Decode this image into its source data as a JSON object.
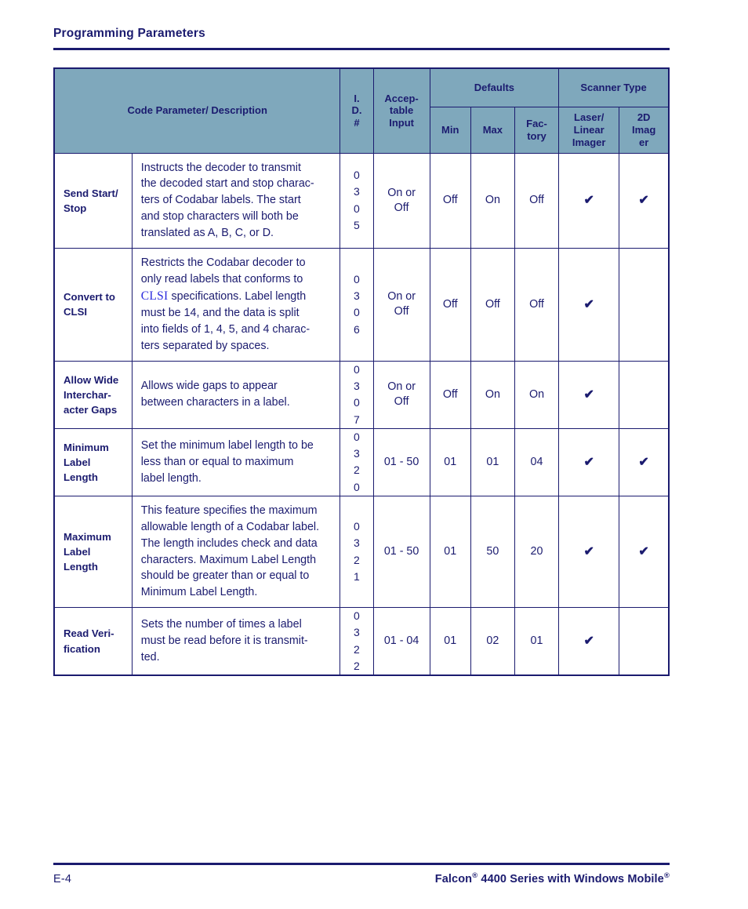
{
  "header": {
    "title": "Programming Parameters"
  },
  "table": {
    "headers": {
      "description": "Code Parameter/ Description",
      "id": "I. D. #",
      "id_lines": [
        "I.",
        "D.",
        "#"
      ],
      "acceptable_input": "Acceptable Input",
      "acceptable_input_lines": [
        "Accep-",
        "table",
        "Input"
      ],
      "defaults_group": "Defaults",
      "scanner_type_group": "Scanner Type",
      "min": "Min",
      "max": "Max",
      "factory": "Factory",
      "factory_lines": [
        "Fac-",
        "tory"
      ],
      "laser_linear_imager": "Laser/ Linear Imager",
      "laser_linear_imager_lines": [
        "Laser/",
        "Linear",
        "Imager"
      ],
      "imager_2d": "2D Imager",
      "imager_2d_lines": [
        "2D",
        "Imag",
        "er"
      ]
    },
    "rows": [
      {
        "name": "Send Start/ Stop",
        "name_lines": [
          "Send Start/",
          "Stop"
        ],
        "description": "Instructs the decoder to transmit the decoded start and stop charac-ters of Codabar labels. The start and stop characters will both be translated as A, B, C, or D.",
        "description_lines": [
          "Instructs the decoder to transmit",
          "the decoded start and stop charac-",
          "ters of Codabar labels. The start",
          "and stop characters will both be",
          "translated as A, B, C, or D."
        ],
        "id": "0305",
        "id_digits": [
          "0",
          "3",
          "0",
          "5"
        ],
        "acceptable_input": "On or Off",
        "acceptable_input_lines": [
          "On or",
          "Off"
        ],
        "min": "Off",
        "max": "On",
        "factory": "Off",
        "laser_linear_imager": "✔",
        "imager_2d": "✔"
      },
      {
        "name": "Convert to CLSI",
        "name_lines": [
          "Convert to",
          "CLSI"
        ],
        "description": "Restricts the Codabar decoder to only read labels that conforms to CLSI specifications. Label length must be 14, and the data is split into fields of 1, 4, 5, and 4 charac-ters separated by spaces.",
        "description_lines": [
          "Restricts the Codabar decoder to",
          "only read labels that conforms to",
          "CLSI specifications. Label length",
          "must be 14, and the data is split",
          "into fields of 1, 4, 5, and 4 charac-",
          "ters separated by spaces."
        ],
        "xref_term": "CLSI",
        "id": "0306",
        "id_digits": [
          "0",
          "3",
          "0",
          "6"
        ],
        "acceptable_input": "On or Off",
        "acceptable_input_lines": [
          "On or",
          "Off"
        ],
        "min": "Off",
        "max": "Off",
        "factory": "Off",
        "laser_linear_imager": "✔",
        "imager_2d": ""
      },
      {
        "name": "Allow Wide Interchar-acter Gaps",
        "name_lines": [
          "Allow Wide",
          "Interchar-",
          "acter Gaps"
        ],
        "description": "Allows wide gaps to appear between characters in a label.",
        "description_lines": [
          "Allows wide gaps to appear",
          "between characters in a label."
        ],
        "id": "0307",
        "id_digits": [
          "0",
          "3",
          "0",
          "7"
        ],
        "acceptable_input": "On or Off",
        "acceptable_input_lines": [
          "On or",
          "Off"
        ],
        "min": "Off",
        "max": "On",
        "factory": "On",
        "laser_linear_imager": "✔",
        "imager_2d": ""
      },
      {
        "name": "Minimum Label Length",
        "name_lines": [
          "Minimum",
          "Label",
          "Length"
        ],
        "description": "Set the minimum label length to be less than or equal to maximum label length.",
        "description_lines": [
          "Set the minimum label length to be",
          "less than or equal to maximum",
          "label length."
        ],
        "id": "0320",
        "id_digits": [
          "0",
          "3",
          "2",
          "0"
        ],
        "acceptable_input": "01 - 50",
        "acceptable_input_lines": [
          "01 - 50"
        ],
        "min": "01",
        "max": "01",
        "factory": "04",
        "laser_linear_imager": "✔",
        "imager_2d": "✔"
      },
      {
        "name": "Maximum Label Length",
        "name_lines": [
          "Maximum",
          "Label",
          "Length"
        ],
        "description": "This feature specifies the maximum allowable length of a Codabar label. The length includes check and data characters. Maximum Label Length should be greater than or equal to Minimum Label Length.",
        "description_lines": [
          "This feature specifies the maximum",
          "allowable length of a Codabar label.",
          "The length includes check and data",
          "characters. Maximum Label Length",
          "should be greater than or equal to",
          "Minimum Label Length."
        ],
        "id": "0321",
        "id_digits": [
          "0",
          "3",
          "2",
          "1"
        ],
        "acceptable_input": "01 - 50",
        "acceptable_input_lines": [
          "01 - 50"
        ],
        "min": "01",
        "max": "50",
        "factory": "20",
        "laser_linear_imager": "✔",
        "imager_2d": "✔"
      },
      {
        "name": "Read Veri-fication",
        "name_lines": [
          "Read Veri-",
          "fication"
        ],
        "description": "Sets the number of times a label must be read before it is transmit-ted.",
        "description_lines": [
          "Sets the number of times a label",
          "must be read before it is transmit-",
          "ted."
        ],
        "id": "0322",
        "id_digits": [
          "0",
          "3",
          "2",
          "2"
        ],
        "acceptable_input": "01 - 04",
        "acceptable_input_lines": [
          "01 - 04"
        ],
        "min": "01",
        "max": "02",
        "factory": "01",
        "laser_linear_imager": "✔",
        "imager_2d": ""
      }
    ]
  },
  "footer": {
    "page_number": "E-4",
    "document_title": "Falcon® 4400 Series with Windows Mobile®",
    "document_title_part1": "Falcon",
    "document_title_reg1": "®",
    "document_title_part2": " 4400 Series with Windows Mobile",
    "document_title_reg2": "®"
  },
  "colors": {
    "ink": "#1b1b6f",
    "header_fill": "#7fa8bc",
    "xref_link": "#2b2bdd"
  }
}
